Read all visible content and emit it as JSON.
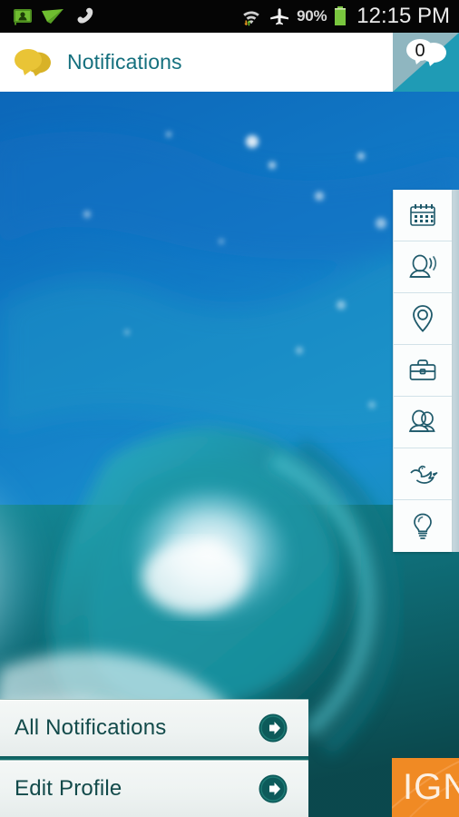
{
  "status_bar": {
    "icons_left": [
      "contact-card-icon",
      "paper-plane-icon",
      "phone-handset-icon"
    ],
    "icons_right": [
      "wifi-icon",
      "airplane-mode-icon",
      "battery-icon"
    ],
    "battery_percent": "90%",
    "clock": "12:15 PM",
    "colors": {
      "background": "#050505",
      "accent_green": "#7cc142",
      "text": "#e8e8e8"
    }
  },
  "header": {
    "title": "Notifications",
    "icon": "speech-bubbles-icon",
    "colors": {
      "background": "#ffffff",
      "title": "#15707e",
      "bubble": "#e3bb2e"
    }
  },
  "badge": {
    "count": "0",
    "icon": "speech-bubbles-icon",
    "colors": {
      "top": "#8fb6c0",
      "bottom": "#1f9bb5"
    }
  },
  "rail": {
    "items": [
      {
        "icon": "calendar-icon",
        "label": "Calendar"
      },
      {
        "icon": "profile-speaking-icon",
        "label": "Profile"
      },
      {
        "icon": "location-pin-icon",
        "label": "Location"
      },
      {
        "icon": "briefcase-icon",
        "label": "Jobs"
      },
      {
        "icon": "people-group-icon",
        "label": "Connections"
      },
      {
        "icon": "bird-icon",
        "label": "Twitter"
      },
      {
        "icon": "lightbulb-icon",
        "label": "Ideas"
      }
    ],
    "colors": {
      "background": "#fbfdfd",
      "stroke": "#1f5a6b",
      "divider": "#d2e2e8"
    }
  },
  "menu": {
    "items": [
      {
        "label": "All Notifications",
        "arrow": "arrow-right-icon"
      },
      {
        "label": "Edit Profile",
        "arrow": "arrow-right-icon"
      }
    ],
    "colors": {
      "background": "#f1f5f4",
      "text": "#124a4a",
      "arrow": "#0d5a5a"
    }
  },
  "ign_panel": {
    "text": "IGN",
    "colors": {
      "background": "#f08a24",
      "text": "#fdf0e2"
    }
  },
  "background": {
    "description": "ocean-wave-photo",
    "colors": {
      "deep_blue": "#0a5fae",
      "mid_blue": "#1789cf",
      "teal": "#15919b",
      "dark_teal": "#0c4f52",
      "foam": "#eaf7fb"
    }
  }
}
